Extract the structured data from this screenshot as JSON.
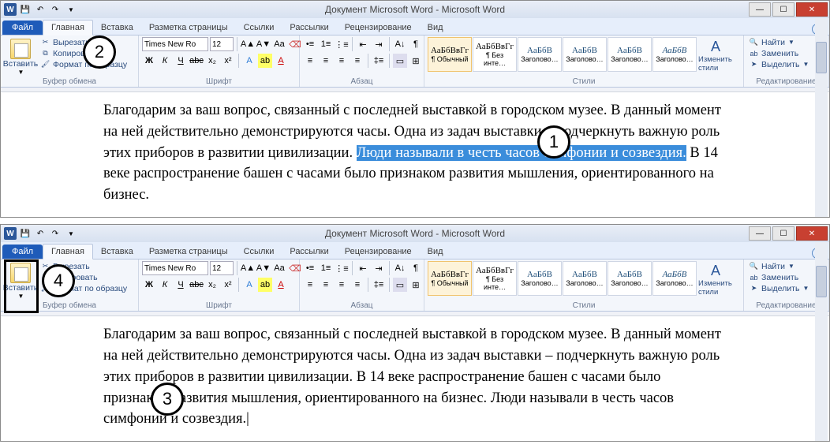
{
  "title": "Документ Microsoft Word  -  Microsoft Word",
  "tabs": {
    "file": "Файл",
    "home": "Главная",
    "insert": "Вставка",
    "pagelayout": "Разметка страницы",
    "references": "Ссылки",
    "mailings": "Рассылки",
    "review": "Рецензирование",
    "view": "Вид"
  },
  "clipboard": {
    "paste": "Вставить",
    "cut": "Вырезать",
    "copy": "Копировать",
    "format_painter": "Формат по образцу",
    "group": "Буфер обмена"
  },
  "font": {
    "name": "Times New Ro",
    "size": "12",
    "group": "Шрифт"
  },
  "paragraph": {
    "group": "Абзац"
  },
  "styles": {
    "group": "Стили",
    "sample": "АаБбВвГг",
    "sample_short": "АаБбВ",
    "s1": "¶ Обычный",
    "s2": "¶ Без инте…",
    "s3": "Заголово…",
    "s4": "Заголово…",
    "s5": "Заголово…",
    "s6": "Заголово…",
    "change": "Изменить стили"
  },
  "editing": {
    "find": "Найти",
    "replace": "Заменить",
    "select": "Выделить",
    "group": "Редактирование"
  },
  "markers": {
    "m1": "1",
    "m2": "2",
    "m3": "3",
    "m4": "4"
  },
  "doc1": {
    "p1a": "Благодарим за ваш вопрос, связанный с последней выставкой в городском музее. В данный момент на ней действительно демонстрируются часы.  Одна из задач выставки – подчеркнуть важную роль этих приборов в развитии цивилизации. ",
    "hl": "Люди называли в честь часов симфонии и созвездия.",
    "p1b": " В 14 веке распространение башен с часами было признаком развития мышления, ориентированного на бизнес."
  },
  "doc2": {
    "p1": "Благодарим за ваш вопрос, связанный с последней выставкой в городском музее. В данный момент на ней действительно демонстрируются часы.  Одна из задач выставки – подчеркнуть важную роль этих приборов в развитии цивилизации.  В 14 веке распространение башен с часами было признаком развития мышления, ориентированного на бизнес. Люди называли в честь часов симфонии и созвездия.|"
  }
}
